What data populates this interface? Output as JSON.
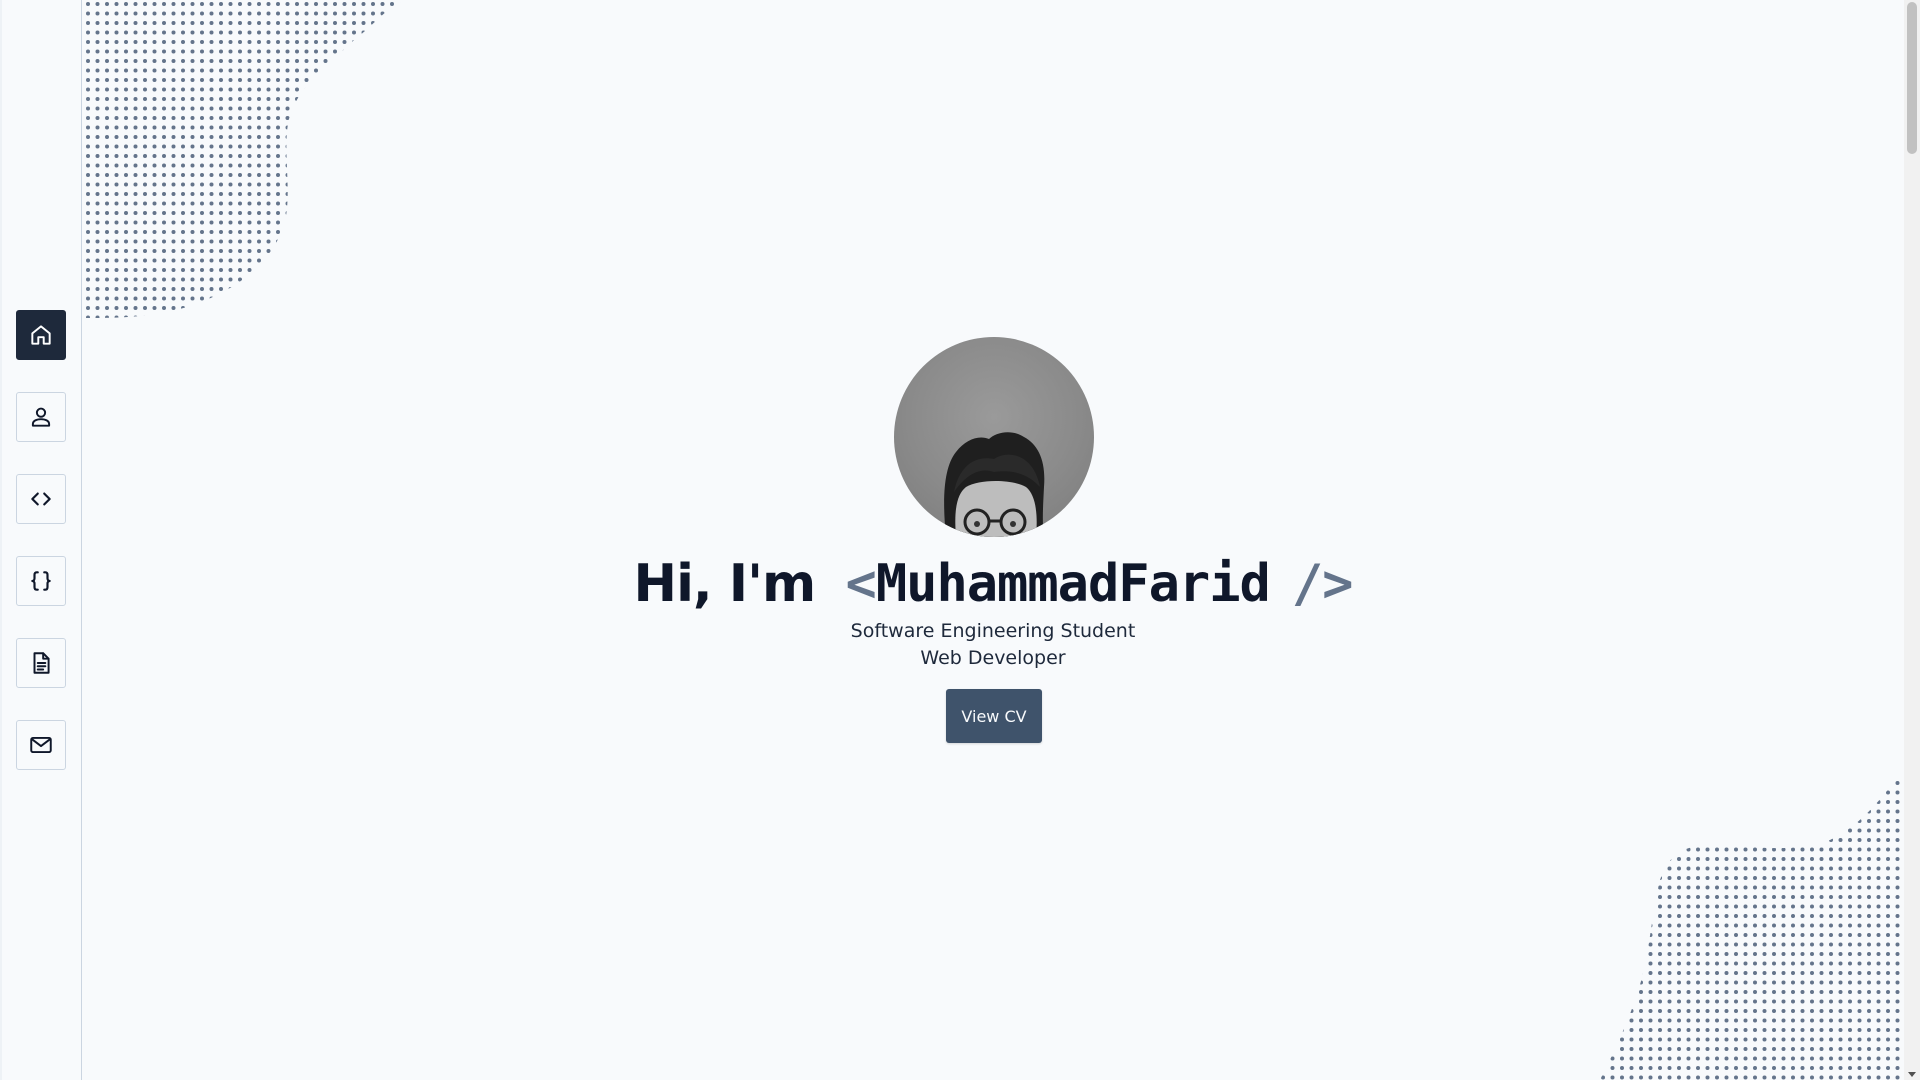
{
  "sidebar": {
    "items": [
      {
        "id": "home",
        "icon": "home-icon",
        "active": true
      },
      {
        "id": "about",
        "icon": "user-icon",
        "active": false
      },
      {
        "id": "skills",
        "icon": "code-icon",
        "active": false
      },
      {
        "id": "projects",
        "icon": "curly-braces-icon",
        "active": false
      },
      {
        "id": "resume",
        "icon": "document-icon",
        "active": false
      },
      {
        "id": "contact",
        "icon": "mail-icon",
        "active": false
      }
    ]
  },
  "hero": {
    "greeting": "Hi, I'm",
    "open_bracket": "<",
    "name": "MuhammadFarid",
    "close_bracket": "/>",
    "subtitle_1": "Software Engineering Student",
    "subtitle_2": "Web Developer",
    "cv_button_label": "View CV"
  },
  "colors": {
    "background": "#f8fafc",
    "sidebar_active": "#1e293b",
    "accent": "#64748b",
    "button": "#3f536b",
    "dots": "#64748b",
    "text": "#0f172a"
  }
}
